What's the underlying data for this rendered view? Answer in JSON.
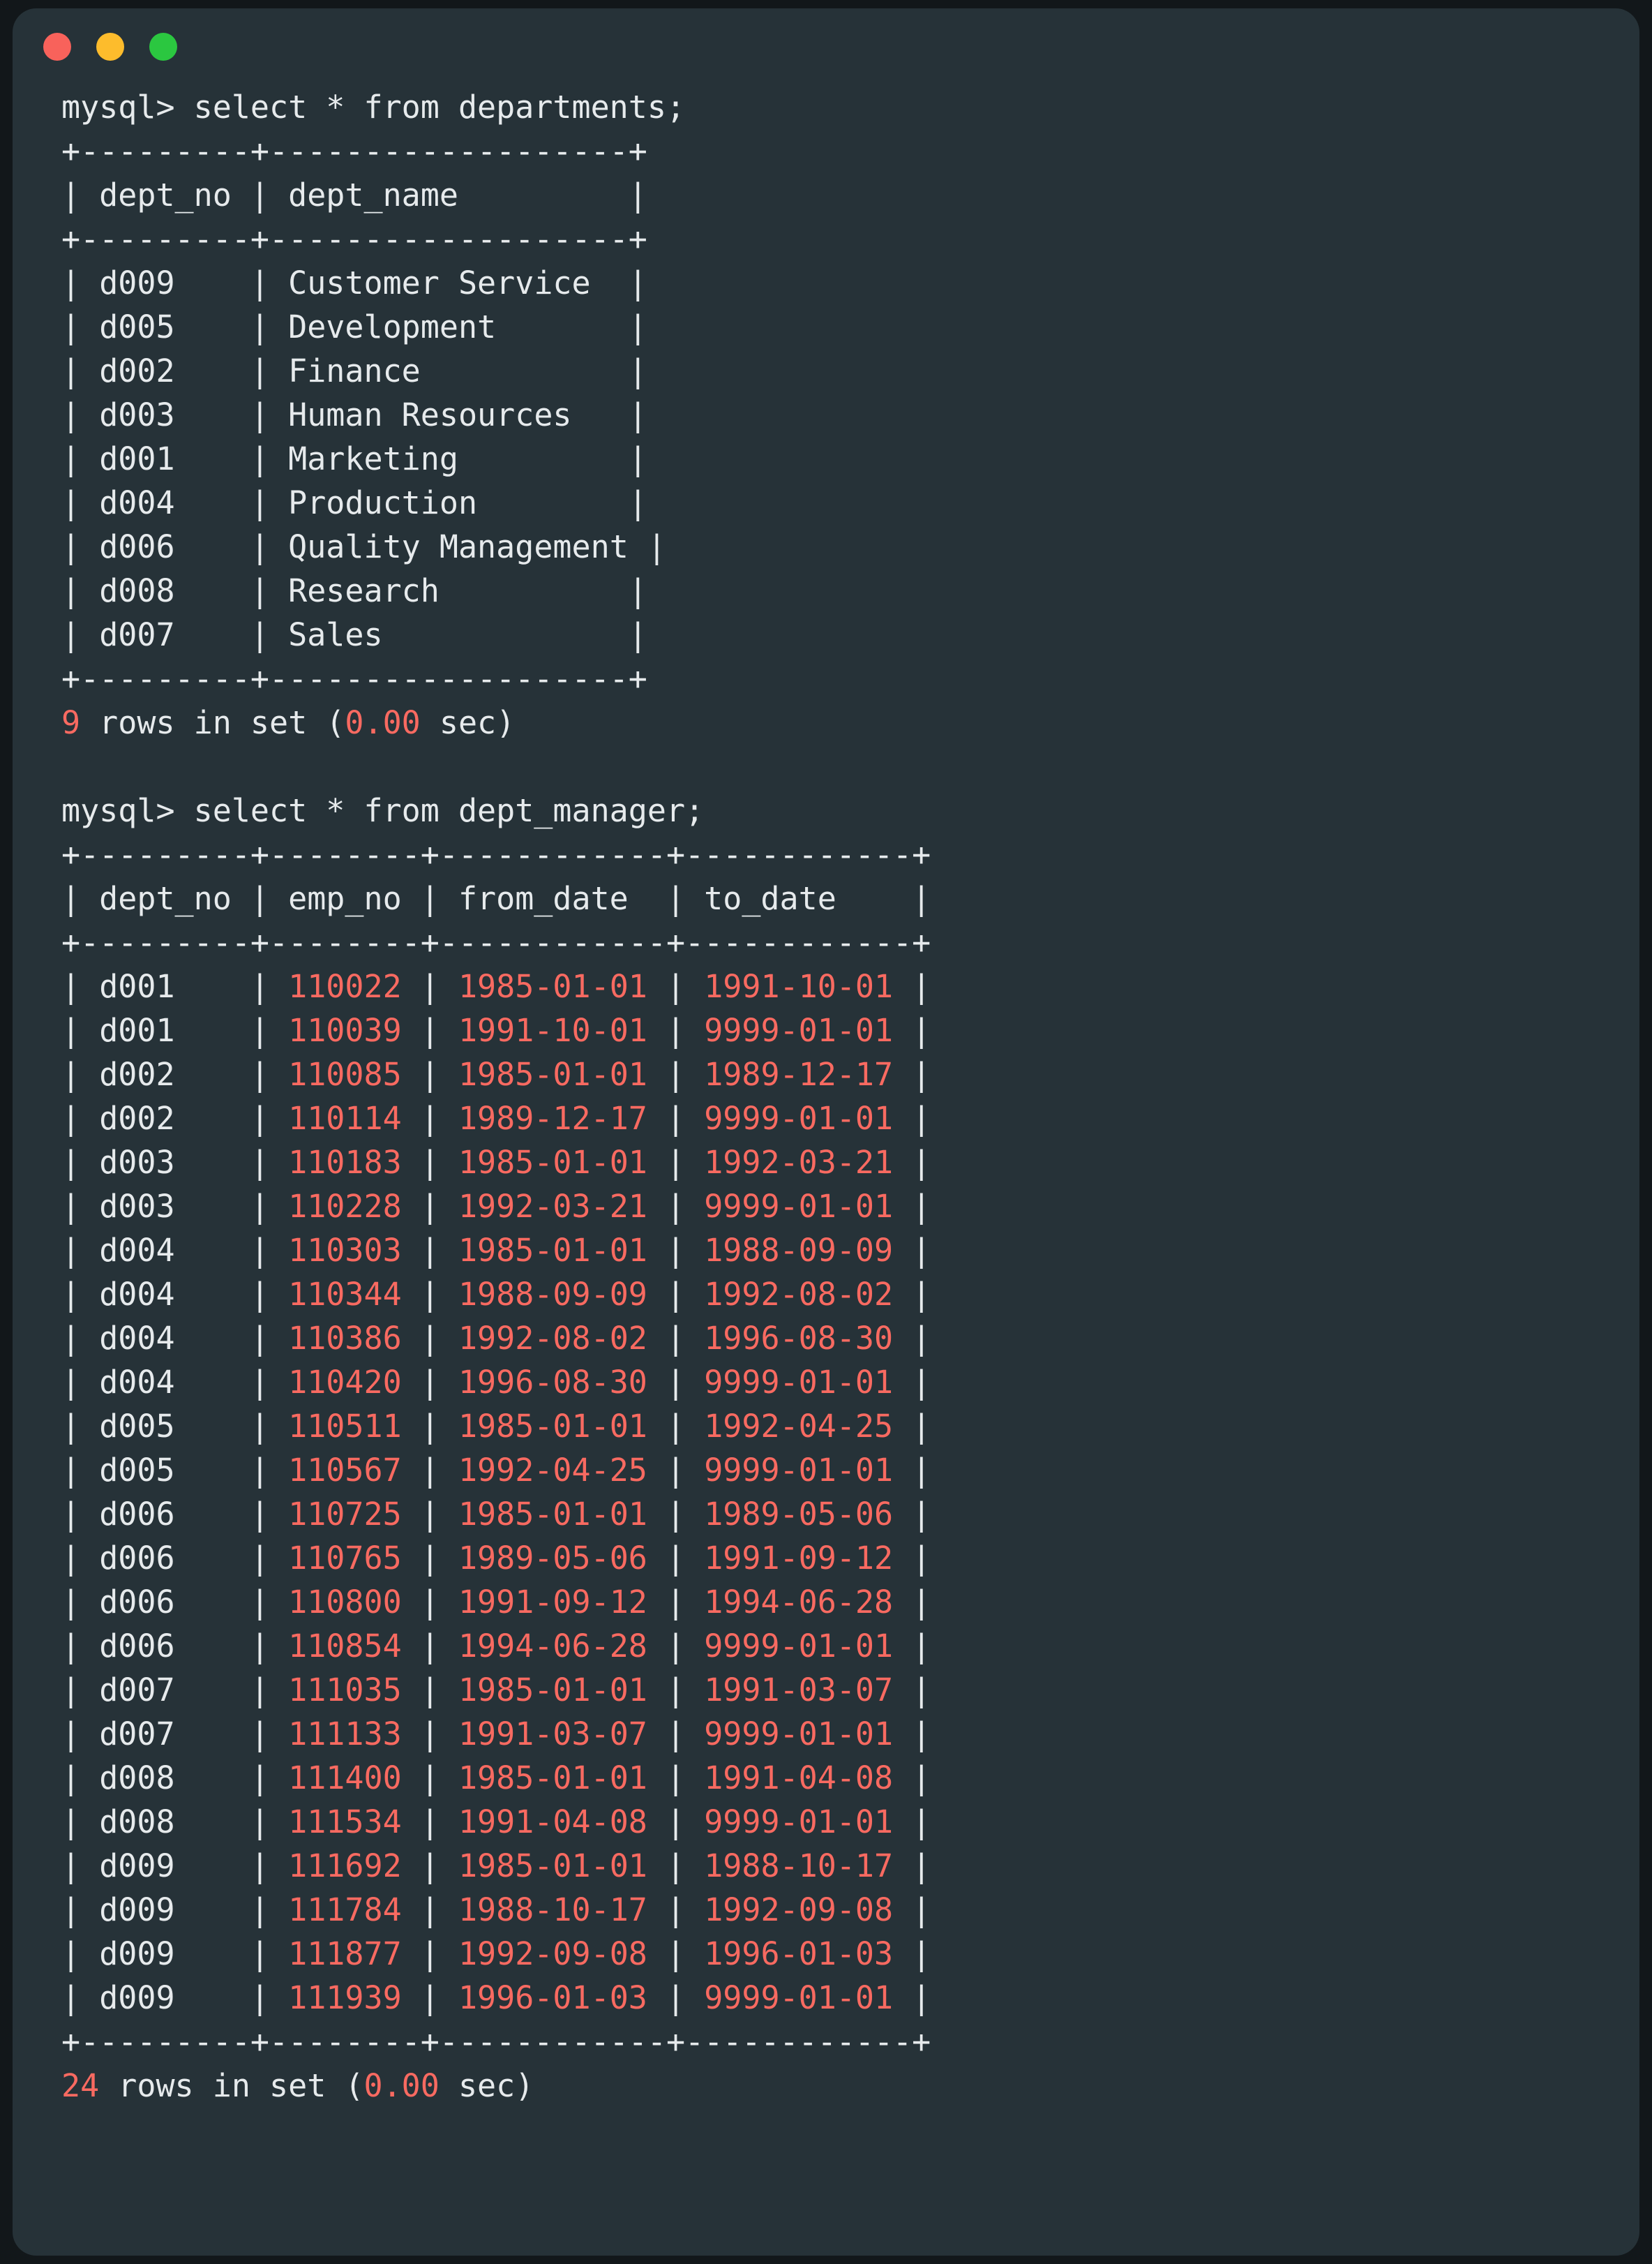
{
  "window": {
    "title_bar": {
      "buttons": [
        {
          "name": "close",
          "color": "#f8625b"
        },
        {
          "name": "minimize",
          "color": "#fdbc2c"
        },
        {
          "name": "maximize",
          "color": "#2bc740"
        }
      ]
    },
    "background_color": "#263238",
    "text_color": "#e6eaec",
    "accent_color": "#f86a61"
  },
  "session": {
    "prompt": "mysql> ",
    "blocks": [
      {
        "command": "select * from departments;",
        "table": {
          "columns": [
            {
              "name": "dept_no",
              "width": 7
            },
            {
              "name": "dept_name",
              "width": 17
            }
          ],
          "rows": [
            [
              "d009",
              "Customer Service"
            ],
            [
              "d005",
              "Development"
            ],
            [
              "d002",
              "Finance"
            ],
            [
              "d003",
              "Human Resources"
            ],
            [
              "d001",
              "Marketing"
            ],
            [
              "d004",
              "Production"
            ],
            [
              "d006",
              "Quality Management"
            ],
            [
              "d008",
              "Research"
            ],
            [
              "d007",
              "Sales"
            ]
          ]
        },
        "footer": {
          "count": "9",
          "label_before": " rows in set (",
          "time": "0.00",
          "label_after": " sec)"
        }
      },
      {
        "command": "select * from dept_manager;",
        "table": {
          "columns": [
            {
              "name": "dept_no",
              "width": 7
            },
            {
              "name": "emp_no",
              "width": 6
            },
            {
              "name": "from_date",
              "width": 10
            },
            {
              "name": "to_date",
              "width": 10
            }
          ],
          "rows": [
            [
              "d001",
              "110022",
              "1985-01-01",
              "1991-10-01"
            ],
            [
              "d001",
              "110039",
              "1991-10-01",
              "9999-01-01"
            ],
            [
              "d002",
              "110085",
              "1985-01-01",
              "1989-12-17"
            ],
            [
              "d002",
              "110114",
              "1989-12-17",
              "9999-01-01"
            ],
            [
              "d003",
              "110183",
              "1985-01-01",
              "1992-03-21"
            ],
            [
              "d003",
              "110228",
              "1992-03-21",
              "9999-01-01"
            ],
            [
              "d004",
              "110303",
              "1985-01-01",
              "1988-09-09"
            ],
            [
              "d004",
              "110344",
              "1988-09-09",
              "1992-08-02"
            ],
            [
              "d004",
              "110386",
              "1992-08-02",
              "1996-08-30"
            ],
            [
              "d004",
              "110420",
              "1996-08-30",
              "9999-01-01"
            ],
            [
              "d005",
              "110511",
              "1985-01-01",
              "1992-04-25"
            ],
            [
              "d005",
              "110567",
              "1992-04-25",
              "9999-01-01"
            ],
            [
              "d006",
              "110725",
              "1985-01-01",
              "1989-05-06"
            ],
            [
              "d006",
              "110765",
              "1989-05-06",
              "1991-09-12"
            ],
            [
              "d006",
              "110800",
              "1991-09-12",
              "1994-06-28"
            ],
            [
              "d006",
              "110854",
              "1994-06-28",
              "9999-01-01"
            ],
            [
              "d007",
              "111035",
              "1985-01-01",
              "1991-03-07"
            ],
            [
              "d007",
              "111133",
              "1991-03-07",
              "9999-01-01"
            ],
            [
              "d008",
              "111400",
              "1985-01-01",
              "1991-04-08"
            ],
            [
              "d008",
              "111534",
              "1991-04-08",
              "9999-01-01"
            ],
            [
              "d009",
              "111692",
              "1985-01-01",
              "1988-10-17"
            ],
            [
              "d009",
              "111784",
              "1988-10-17",
              "1992-09-08"
            ],
            [
              "d009",
              "111877",
              "1992-09-08",
              "1996-01-03"
            ],
            [
              "d009",
              "111939",
              "1996-01-03",
              "9999-01-01"
            ]
          ]
        },
        "footer": {
          "count": "24",
          "label_before": " rows in set (",
          "time": "0.00",
          "label_after": " sec)"
        }
      }
    ]
  }
}
